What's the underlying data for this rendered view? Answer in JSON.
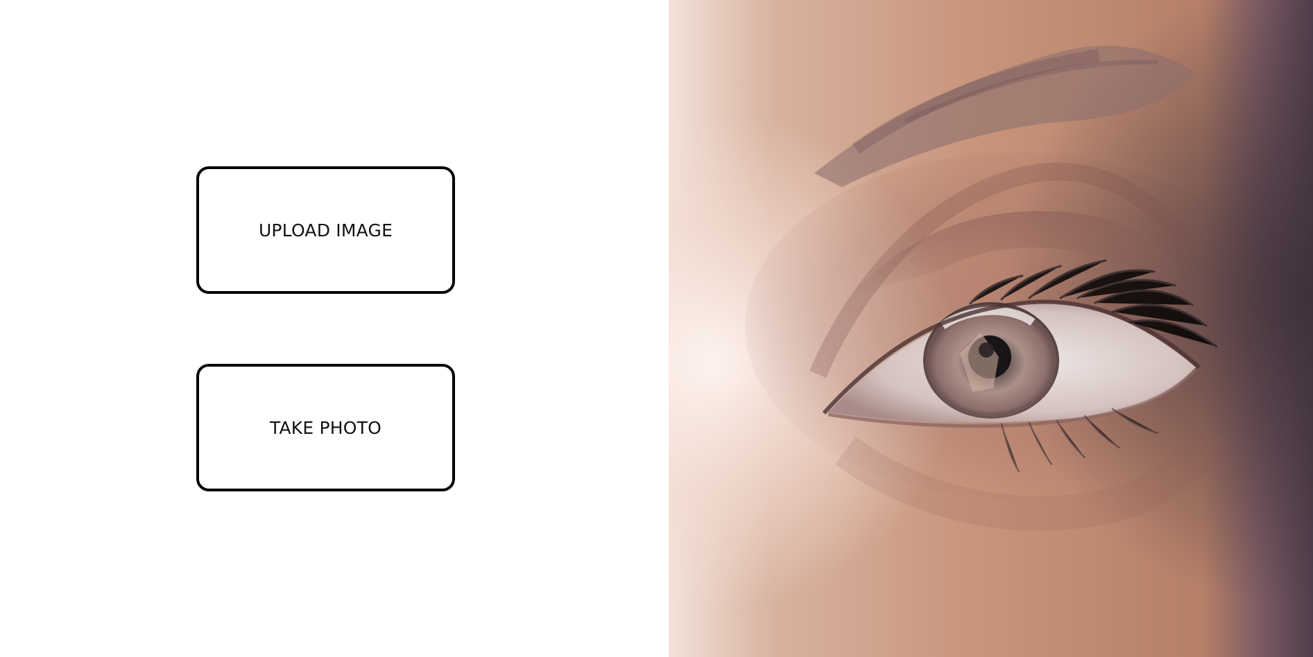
{
  "actions": {
    "upload_label": "UPLOAD IMAGE",
    "take_photo_label": "TAKE PHOTO"
  },
  "photo": {
    "subject": "close-up eye photograph"
  },
  "colors": {
    "background": "#ffffff",
    "button_border": "#000000",
    "button_text": "#111111",
    "skin_tone": "#c89b84"
  }
}
